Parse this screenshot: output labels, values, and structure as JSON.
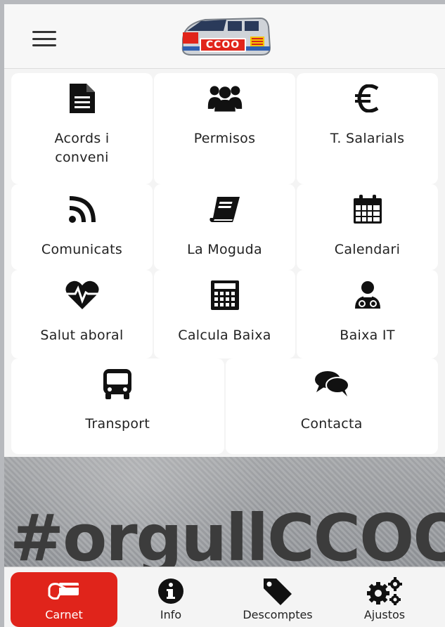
{
  "header": {
    "logo_text": "CCOO",
    "icons": {
      "menu": "hamburger-menu-icon",
      "logo": "train-logo"
    }
  },
  "grid": {
    "rows": [
      [
        {
          "label": "Acords i\nconveni",
          "icon": "document-icon"
        },
        {
          "label": "Permisos",
          "icon": "users-icon"
        },
        {
          "label": "T. Salarials",
          "icon": "euro-icon"
        }
      ],
      [
        {
          "label": "Comunicats",
          "icon": "rss-icon"
        },
        {
          "label": "La Moguda",
          "icon": "book-icon"
        },
        {
          "label": "Calendari",
          "icon": "calendar-icon"
        }
      ],
      [
        {
          "label": "Salut aboral",
          "icon": "heartbeat-icon"
        },
        {
          "label": "Calcula Baixa",
          "icon": "calculator-icon"
        },
        {
          "label": "Baixa IT",
          "icon": "doctor-icon"
        }
      ],
      [
        {
          "label": "Transport",
          "icon": "bus-icon"
        },
        {
          "label": "Contacta",
          "icon": "chat-icon"
        }
      ]
    ]
  },
  "banner": {
    "text": "#orgullCCOO"
  },
  "bottom_nav": {
    "items": [
      {
        "label": "Carnet",
        "icon": "card-hand-icon",
        "active": true
      },
      {
        "label": "Info",
        "icon": "info-icon",
        "active": false
      },
      {
        "label": "Descomptes",
        "icon": "tag-icon",
        "active": false
      },
      {
        "label": "Ajustos",
        "icon": "gears-icon",
        "active": false
      }
    ]
  },
  "colors": {
    "accent": "#e0241b",
    "text": "#222222",
    "tile_bg": "#ffffff"
  }
}
